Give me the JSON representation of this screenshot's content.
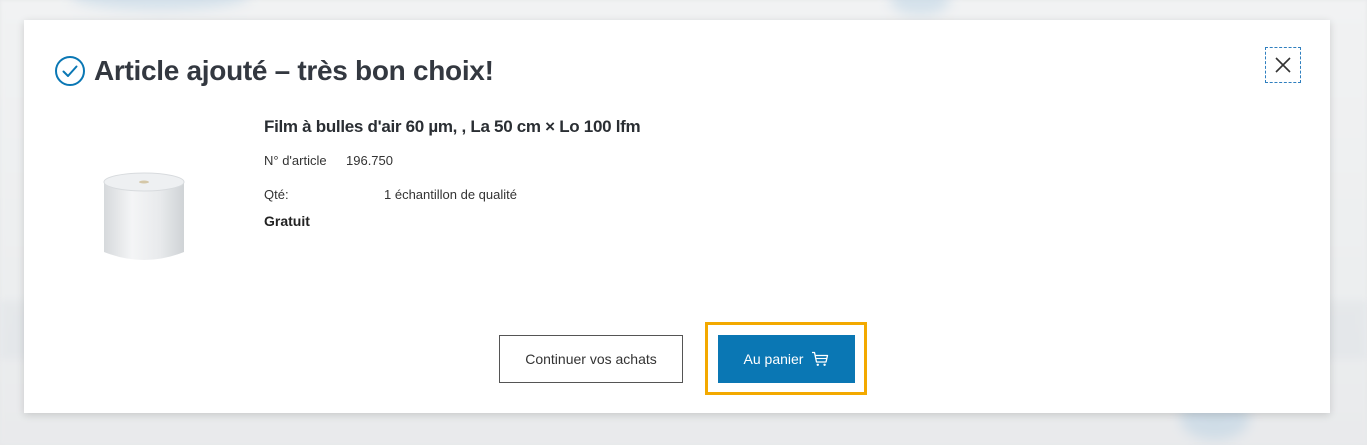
{
  "modal": {
    "title": "Article ajouté – très bon choix!",
    "close_label": "×"
  },
  "product": {
    "name": "Film à bulles d'air 60 µm, , La 50 cm × Lo 100 lfm",
    "article_label": "N° d'article",
    "article_number": "196.750",
    "qty_label": "Qté:",
    "qty_value": "1 échantillon de qualité",
    "price_note": "Gratuit"
  },
  "actions": {
    "continue_label": "Continuer vos achats",
    "cart_label": "Au panier"
  },
  "icons": {
    "success": "check-circle-icon",
    "close": "close-icon",
    "cart": "cart-icon"
  },
  "colors": {
    "accent": "#0a77b4",
    "highlight": "#f3a900",
    "title": "#333840"
  }
}
